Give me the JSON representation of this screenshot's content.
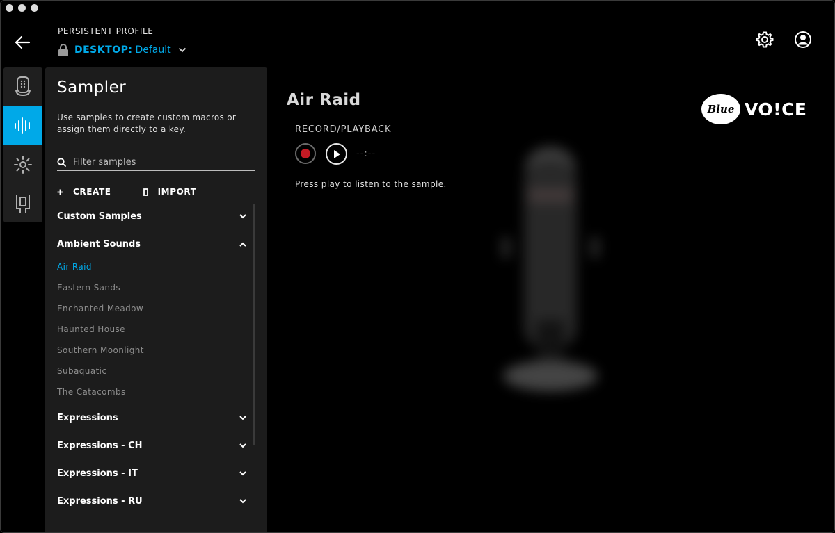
{
  "window": {
    "controls": [
      "close",
      "minimize",
      "maximize"
    ]
  },
  "header": {
    "profile_label": "PERSISTENT PROFILE",
    "device": "DESKTOP:",
    "profile_name": "Default",
    "icons": {
      "back": "arrow-left-icon",
      "settings": "gear-icon",
      "account": "user-icon"
    }
  },
  "rail": {
    "items": [
      {
        "icon": "microphone-icon",
        "active": false
      },
      {
        "icon": "waveform-icon",
        "active": true
      },
      {
        "icon": "brightness-icon",
        "active": false
      },
      {
        "icon": "connector-icon",
        "active": false
      }
    ],
    "accent": "#00a9e8"
  },
  "sampler": {
    "title": "Sampler",
    "description": "Use samples to create custom macros or assign them directly to a key.",
    "filter_placeholder": "Filter samples",
    "create_label": "CREATE",
    "import_label": "IMPORT",
    "categories": [
      {
        "name": "Custom Samples",
        "expanded": false
      },
      {
        "name": "Ambient Sounds",
        "expanded": true,
        "samples": [
          "Air Raid",
          "Eastern Sands",
          "Enchanted Meadow",
          "Haunted House",
          "Southern Moonlight",
          "Subaquatic",
          "The Catacombs"
        ],
        "selected": "Air Raid"
      },
      {
        "name": "Expressions",
        "expanded": false
      },
      {
        "name": "Expressions - CH",
        "expanded": false
      },
      {
        "name": "Expressions - IT",
        "expanded": false
      },
      {
        "name": "Expressions - RU",
        "expanded": false
      }
    ]
  },
  "detail": {
    "title": "Air Raid",
    "section_label": "RECORD/PLAYBACK",
    "time": "--:--",
    "hint": "Press play to listen to the sample.",
    "record_color": "#c41a24"
  },
  "brand": {
    "logo_mark": "Blue",
    "logo_word": "VO!CE"
  }
}
